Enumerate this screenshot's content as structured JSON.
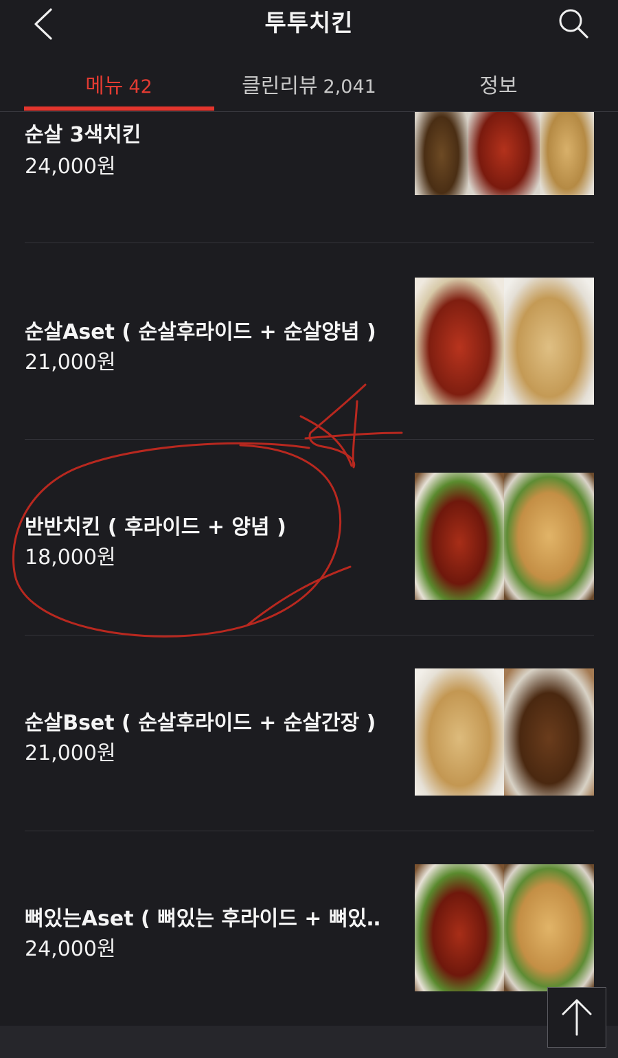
{
  "header": {
    "title": "투투치킨"
  },
  "tabs": [
    {
      "label": "메뉴",
      "count": "42",
      "active": true
    },
    {
      "label": "클린리뷰",
      "count": "2,041",
      "active": false
    },
    {
      "label": "정보",
      "count": "",
      "active": false
    }
  ],
  "menu_items": [
    {
      "name": "순살 3색치킨",
      "price": "24,000원"
    },
    {
      "name": "순살Aset ( 순살후라이드 + 순살양념 )",
      "price": "21,000원"
    },
    {
      "name": "반반치킨 ( 후라이드 + 양념 )",
      "price": "18,000원"
    },
    {
      "name": "순살Bset ( 순살후라이드 + 순살간장 )",
      "price": "21,000원"
    },
    {
      "name": "뼈있는Aset ( 뼈있는 후라이드 + 뼈있…",
      "price": "24,000원"
    }
  ],
  "icons": {
    "back": "chevron-left-icon",
    "search": "search-icon",
    "scroll_top": "arrow-up-icon"
  },
  "colors": {
    "background": "#1c1c20",
    "accent": "#e3352d",
    "annotation": "#b8281f"
  }
}
